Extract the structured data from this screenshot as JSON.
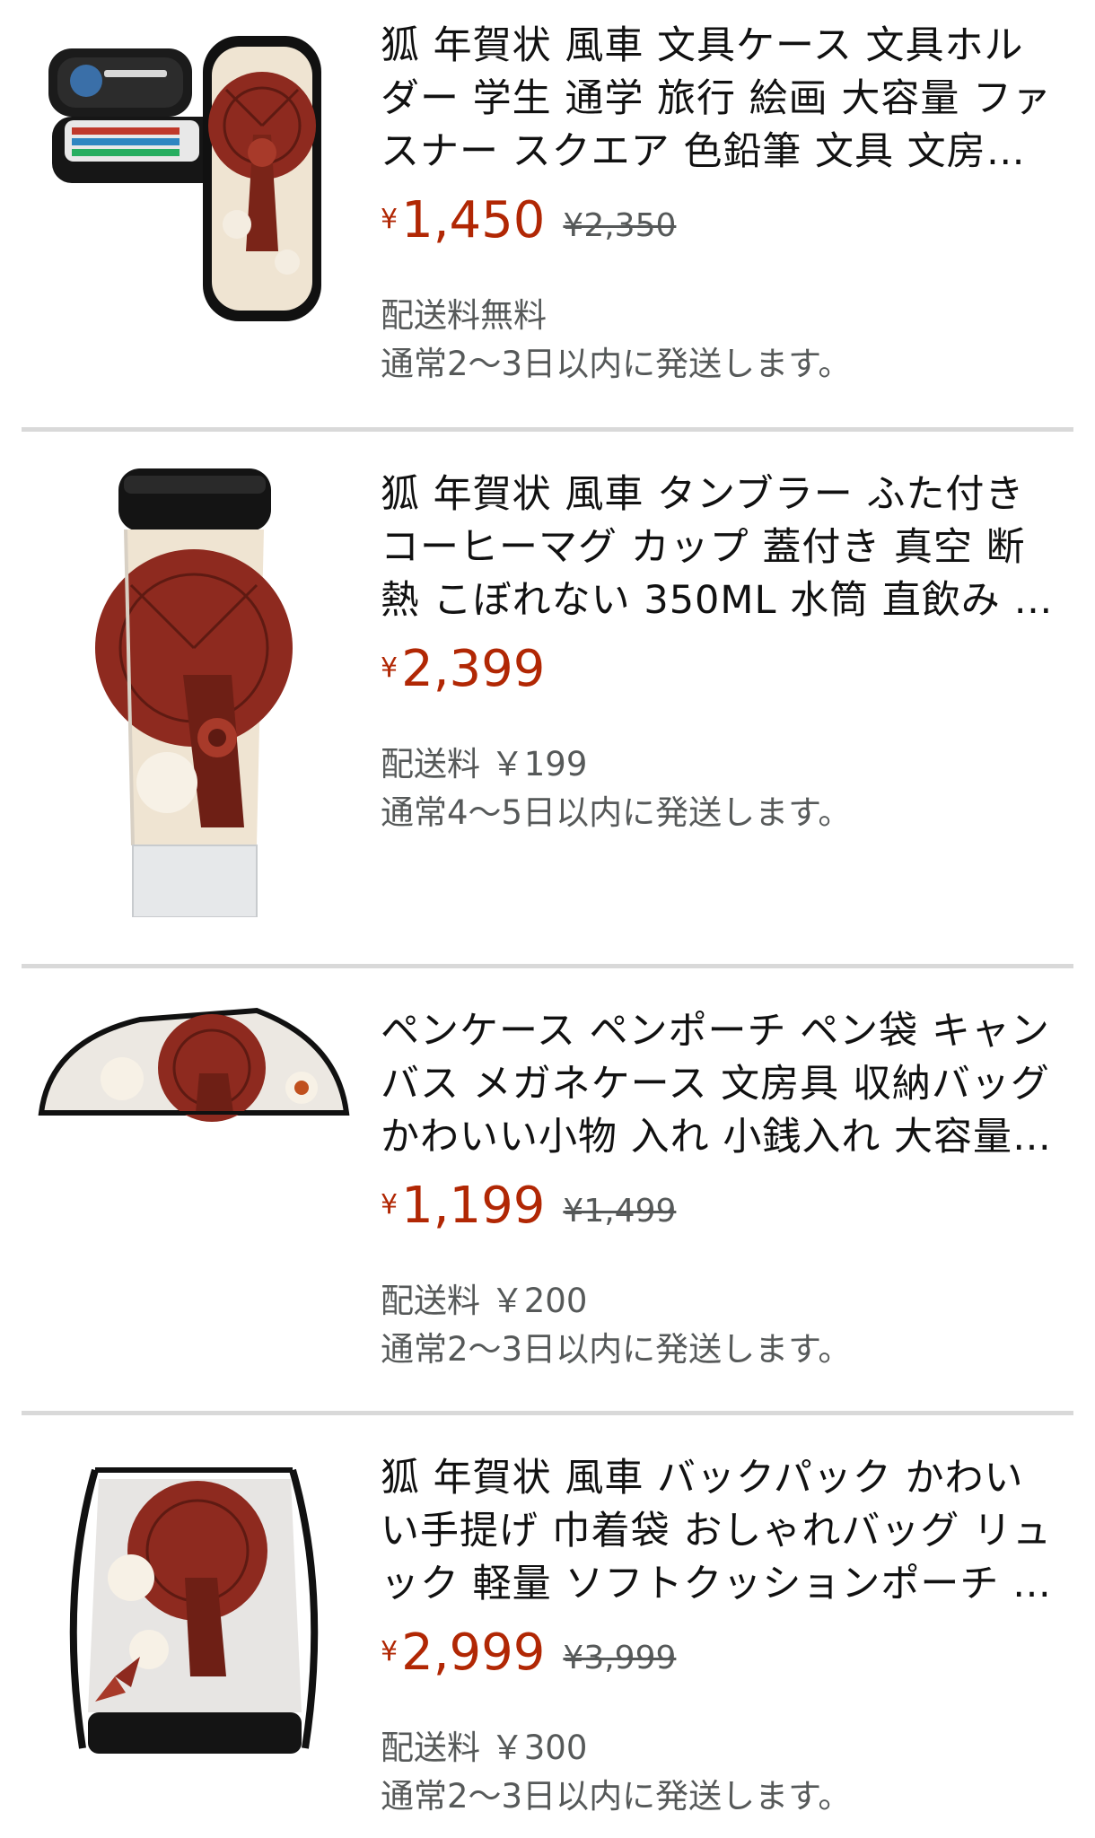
{
  "products": [
    {
      "title": "狐 年賀状 風車 文具ケース 文具ホルダー 学生 通学 旅行 絵画 大容量 ファスナー スクエア 色鉛筆 文具 文房具 小物入れ",
      "yen": "¥",
      "price": "1,450",
      "list_price": "¥2,350",
      "shipping_fee": "配送料無料",
      "delivery": "通常2～3日以内に発送します。",
      "image_icon": "pencil-case-product-image"
    },
    {
      "title": "狐 年賀状 風車 タンブラー ふた付き コーヒーマグ カップ 蓋付き 真空 断熱 こぼれない 350ML 水筒 直飲み 軽量",
      "yen": "¥",
      "price": "2,399",
      "list_price": "",
      "shipping_fee": "配送料 ￥199",
      "delivery": "通常4～5日以内に発送します。",
      "image_icon": "tumbler-product-image"
    },
    {
      "title": "ペンケース ペンポーチ ペン袋 キャンバス メガネケース 文房具 収納バッグ かわいい小物 入れ 小銭入れ 大容量 軽量",
      "yen": "¥",
      "price": "1,199",
      "list_price": "¥1,499",
      "shipping_fee": "配送料 ￥200",
      "delivery": "通常2～3日以内に発送します。",
      "image_icon": "pen-pouch-product-image"
    },
    {
      "title": "狐 年賀状 風車 バックパック かわいい手提げ 巾着袋 おしゃれバッグ リュック 軽量 ソフトクッションポーチ バッグ",
      "yen": "¥",
      "price": "2,999",
      "list_price": "¥3,999",
      "shipping_fee": "配送料 ￥300",
      "delivery": "通常2～3日以内に発送します。",
      "image_icon": "drawstring-backpack-product-image"
    }
  ],
  "colors": {
    "price": "#b12704",
    "secondary_text": "#565959",
    "divider": "#d9d9d9",
    "artwork_red": "#8e2a1f",
    "artwork_cream": "#efe4d2"
  }
}
